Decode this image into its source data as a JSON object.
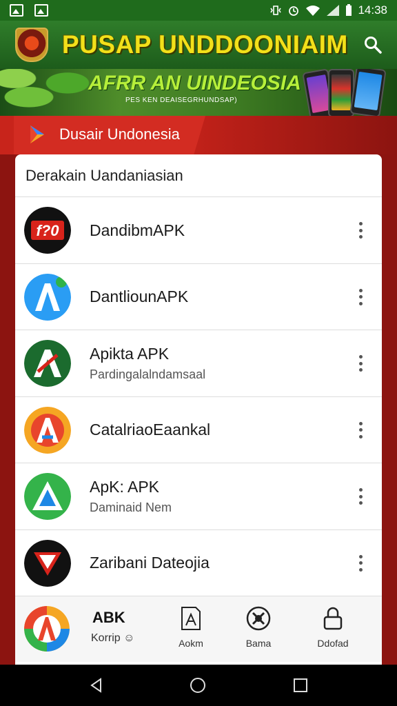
{
  "status_bar": {
    "time": "14:38"
  },
  "header": {
    "title": "PUSAP UNDDOONIAIM"
  },
  "banner": {
    "title": "AFRR AN UINDEOSIA",
    "subtitle": "PES KEN DEAISEGRHUNDSAP)"
  },
  "section": {
    "label": "Dusair Undonesia"
  },
  "list": {
    "title": "Derakain Uandaniasian",
    "items": [
      {
        "name": "DandibmAPK",
        "sub": "",
        "icon": "red-letter-app-icon"
      },
      {
        "name": "DantliounAPK",
        "sub": "",
        "icon": "blue-a-app-icon"
      },
      {
        "name": "Apikta APK",
        "sub": "Pardingalalndamsaal",
        "icon": "green-a-app-icon"
      },
      {
        "name": "CatalriaoEaankal",
        "sub": "",
        "icon": "orange-a-app-icon"
      },
      {
        "name": "ApK: APK",
        "sub": "Daminaid Nem",
        "icon": "green-triangle-app-icon"
      },
      {
        "name": "Zaribani Dateojia",
        "sub": "",
        "icon": "red-arrow-app-icon"
      }
    ]
  },
  "bottom_nav": {
    "home_label": "ABK",
    "home_sub": "Korrip",
    "tabs": [
      {
        "label": "Aokm",
        "icon": "document-icon"
      },
      {
        "label": "Bama",
        "icon": "tools-icon"
      },
      {
        "label": "Ddofad",
        "icon": "lock-icon"
      }
    ]
  },
  "colors": {
    "header_green": "#1f6b1c",
    "title_yellow": "#f2e01a",
    "section_red": "#c8241b",
    "background_red": "#8c1410"
  }
}
